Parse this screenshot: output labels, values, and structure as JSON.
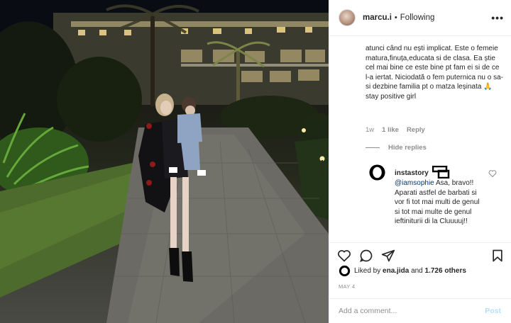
{
  "post": {
    "username": "marcu.i",
    "follow_status": "Following",
    "dot": "•",
    "more": "•••"
  },
  "comment": {
    "text": "atunci când nu ești implicat. Este o femeie matura,finuța,educata si de clasa. Ea știe cel mai bine ce este bine pt fam ei si de ce l-a iertat. Niciodată o fem puternica nu o sa-si dezbine familia pt o matza leșinata 🙏 stay positive girl",
    "age": "1w",
    "likes": "1 like",
    "reply": "Reply",
    "hide_replies": "Hide replies"
  },
  "reply": {
    "username": "instastory",
    "mention": "@iamsophie",
    "text": "Asa, bravo!! Aparati astfel de barbati si vor fi tot mai multi de genul si tot mai multe de genul ieftiniturii di la Cluuuuj!!"
  },
  "likes": {
    "prefix": "Liked by",
    "user": "ena.jida",
    "and": "and",
    "count": "1.726 others"
  },
  "date": "MAY 4",
  "add_comment": {
    "placeholder": "Add a comment...",
    "post_label": "Post"
  },
  "icons": {
    "like": "heart-icon",
    "comment": "comment-icon",
    "share": "share-icon",
    "save": "bookmark-icon"
  }
}
